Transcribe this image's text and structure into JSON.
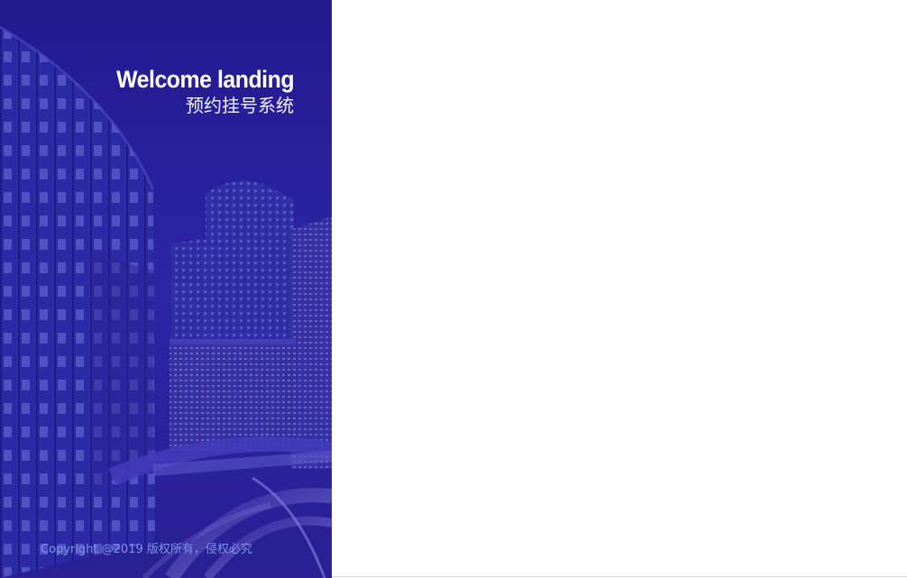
{
  "branding": {
    "title": "Welcome landing",
    "subtitle": "预约挂号系统"
  },
  "footer": {
    "copyright": "Copyright @2019 版权所有，侵权必究"
  },
  "colors": {
    "panel_primary": "#2b2498",
    "copyright_text": "#7f95e6",
    "background": "#ffffff"
  }
}
